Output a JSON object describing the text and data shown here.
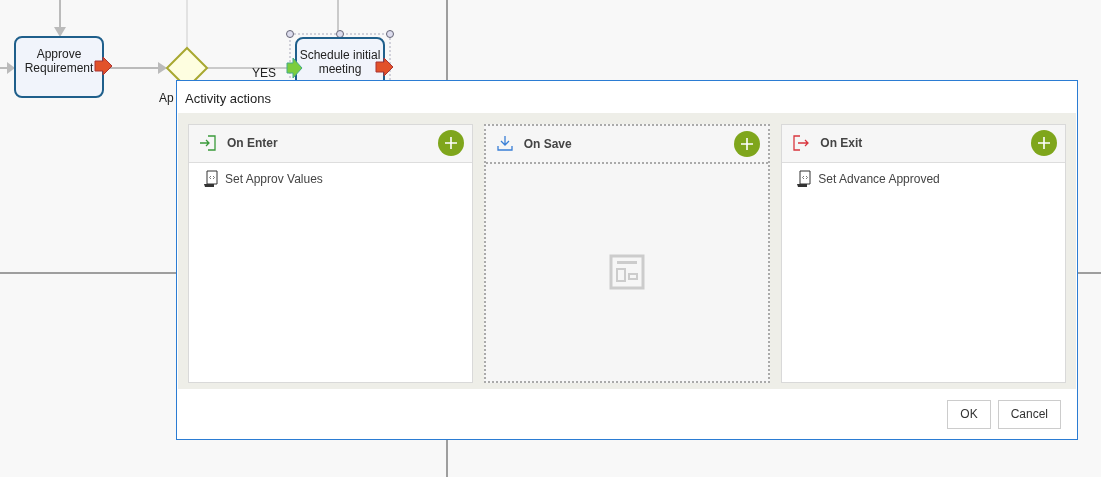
{
  "diagram": {
    "tasks": [
      {
        "label": "Approve Requirement",
        "selected": false
      },
      {
        "label": "Schedule initial meeting",
        "selected": true
      }
    ],
    "gateway": {
      "label": "Ap"
    },
    "flow_labels": [
      "YES"
    ]
  },
  "dialog": {
    "title": "Activity actions",
    "sections": [
      {
        "kind": "enter",
        "title": "On Enter",
        "selected": false,
        "actions": [
          "Set Approv Values"
        ]
      },
      {
        "kind": "save",
        "title": "On Save",
        "selected": true
      },
      {
        "kind": "exit",
        "title": "On Exit",
        "selected": false,
        "actions": [
          "Set Advance Approved"
        ]
      }
    ],
    "buttons": [
      "OK",
      "Cancel"
    ]
  }
}
